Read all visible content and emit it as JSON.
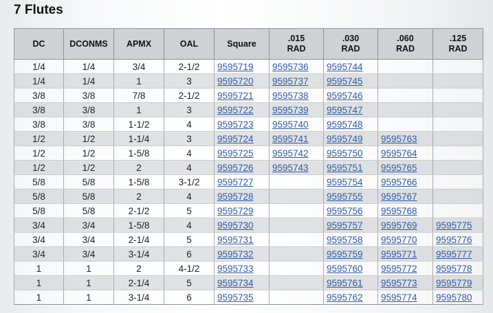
{
  "title": "7 Flutes",
  "colors": {
    "link": "#2f5aa6",
    "header_bg": "#cfd1d4"
  },
  "table": {
    "headers": [
      {
        "line1": "DC",
        "line2": ""
      },
      {
        "line1": "DCONMS",
        "line2": ""
      },
      {
        "line1": "APMX",
        "line2": ""
      },
      {
        "line1": "OAL",
        "line2": ""
      },
      {
        "line1": "Square",
        "line2": ""
      },
      {
        "line1": ".015",
        "line2": "RAD"
      },
      {
        "line1": ".030",
        "line2": "RAD"
      },
      {
        "line1": ".060",
        "line2": "RAD"
      },
      {
        "line1": ".125",
        "line2": "RAD"
      }
    ],
    "rows": [
      [
        "1/4",
        "1/4",
        "3/4",
        "2-1/2",
        "9595719",
        "9595736",
        "9595744",
        "",
        ""
      ],
      [
        "1/4",
        "1/4",
        "1",
        "3",
        "9595720",
        "9595737",
        "9595745",
        "",
        ""
      ],
      [
        "3/8",
        "3/8",
        "7/8",
        "2-1/2",
        "9595721",
        "9595738",
        "9595746",
        "",
        ""
      ],
      [
        "3/8",
        "3/8",
        "1",
        "3",
        "9595722",
        "9595739",
        "9595747",
        "",
        ""
      ],
      [
        "3/8",
        "3/8",
        "1-1/2",
        "4",
        "9595723",
        "9595740",
        "9595748",
        "",
        ""
      ],
      [
        "1/2",
        "1/2",
        "1-1/4",
        "3",
        "9595724",
        "9595741",
        "9595749",
        "9595763",
        ""
      ],
      [
        "1/2",
        "1/2",
        "1-5/8",
        "4",
        "9595725",
        "9595742",
        "9595750",
        "9595764",
        ""
      ],
      [
        "1/2",
        "1/2",
        "2",
        "4",
        "9595726",
        "9595743",
        "9595751",
        "9595765",
        ""
      ],
      [
        "5/8",
        "5/8",
        "1-5/8",
        "3-1/2",
        "9595727",
        "",
        "9595754",
        "9595766",
        ""
      ],
      [
        "5/8",
        "5/8",
        "2",
        "4",
        "9595728",
        "",
        "9595755",
        "9595767",
        ""
      ],
      [
        "5/8",
        "5/8",
        "2-1/2",
        "5",
        "9595729",
        "",
        "9595756",
        "9595768",
        ""
      ],
      [
        "3/4",
        "3/4",
        "1-5/8",
        "4",
        "9595730",
        "",
        "9595757",
        "9595769",
        "9595775"
      ],
      [
        "3/4",
        "3/4",
        "2-1/4",
        "5",
        "9595731",
        "",
        "9595758",
        "9595770",
        "9595776"
      ],
      [
        "3/4",
        "3/4",
        "3-1/4",
        "6",
        "9595732",
        "",
        "9595759",
        "9595771",
        "9595777"
      ],
      [
        "1",
        "1",
        "2",
        "4-1/2",
        "9595733",
        "",
        "9595760",
        "9595772",
        "9595778"
      ],
      [
        "1",
        "1",
        "2-1/4",
        "5",
        "9595734",
        "",
        "9595761",
        "9595773",
        "9595779"
      ],
      [
        "1",
        "1",
        "3-1/4",
        "6",
        "9595735",
        "",
        "9595762",
        "9595774",
        "9595780"
      ]
    ]
  }
}
